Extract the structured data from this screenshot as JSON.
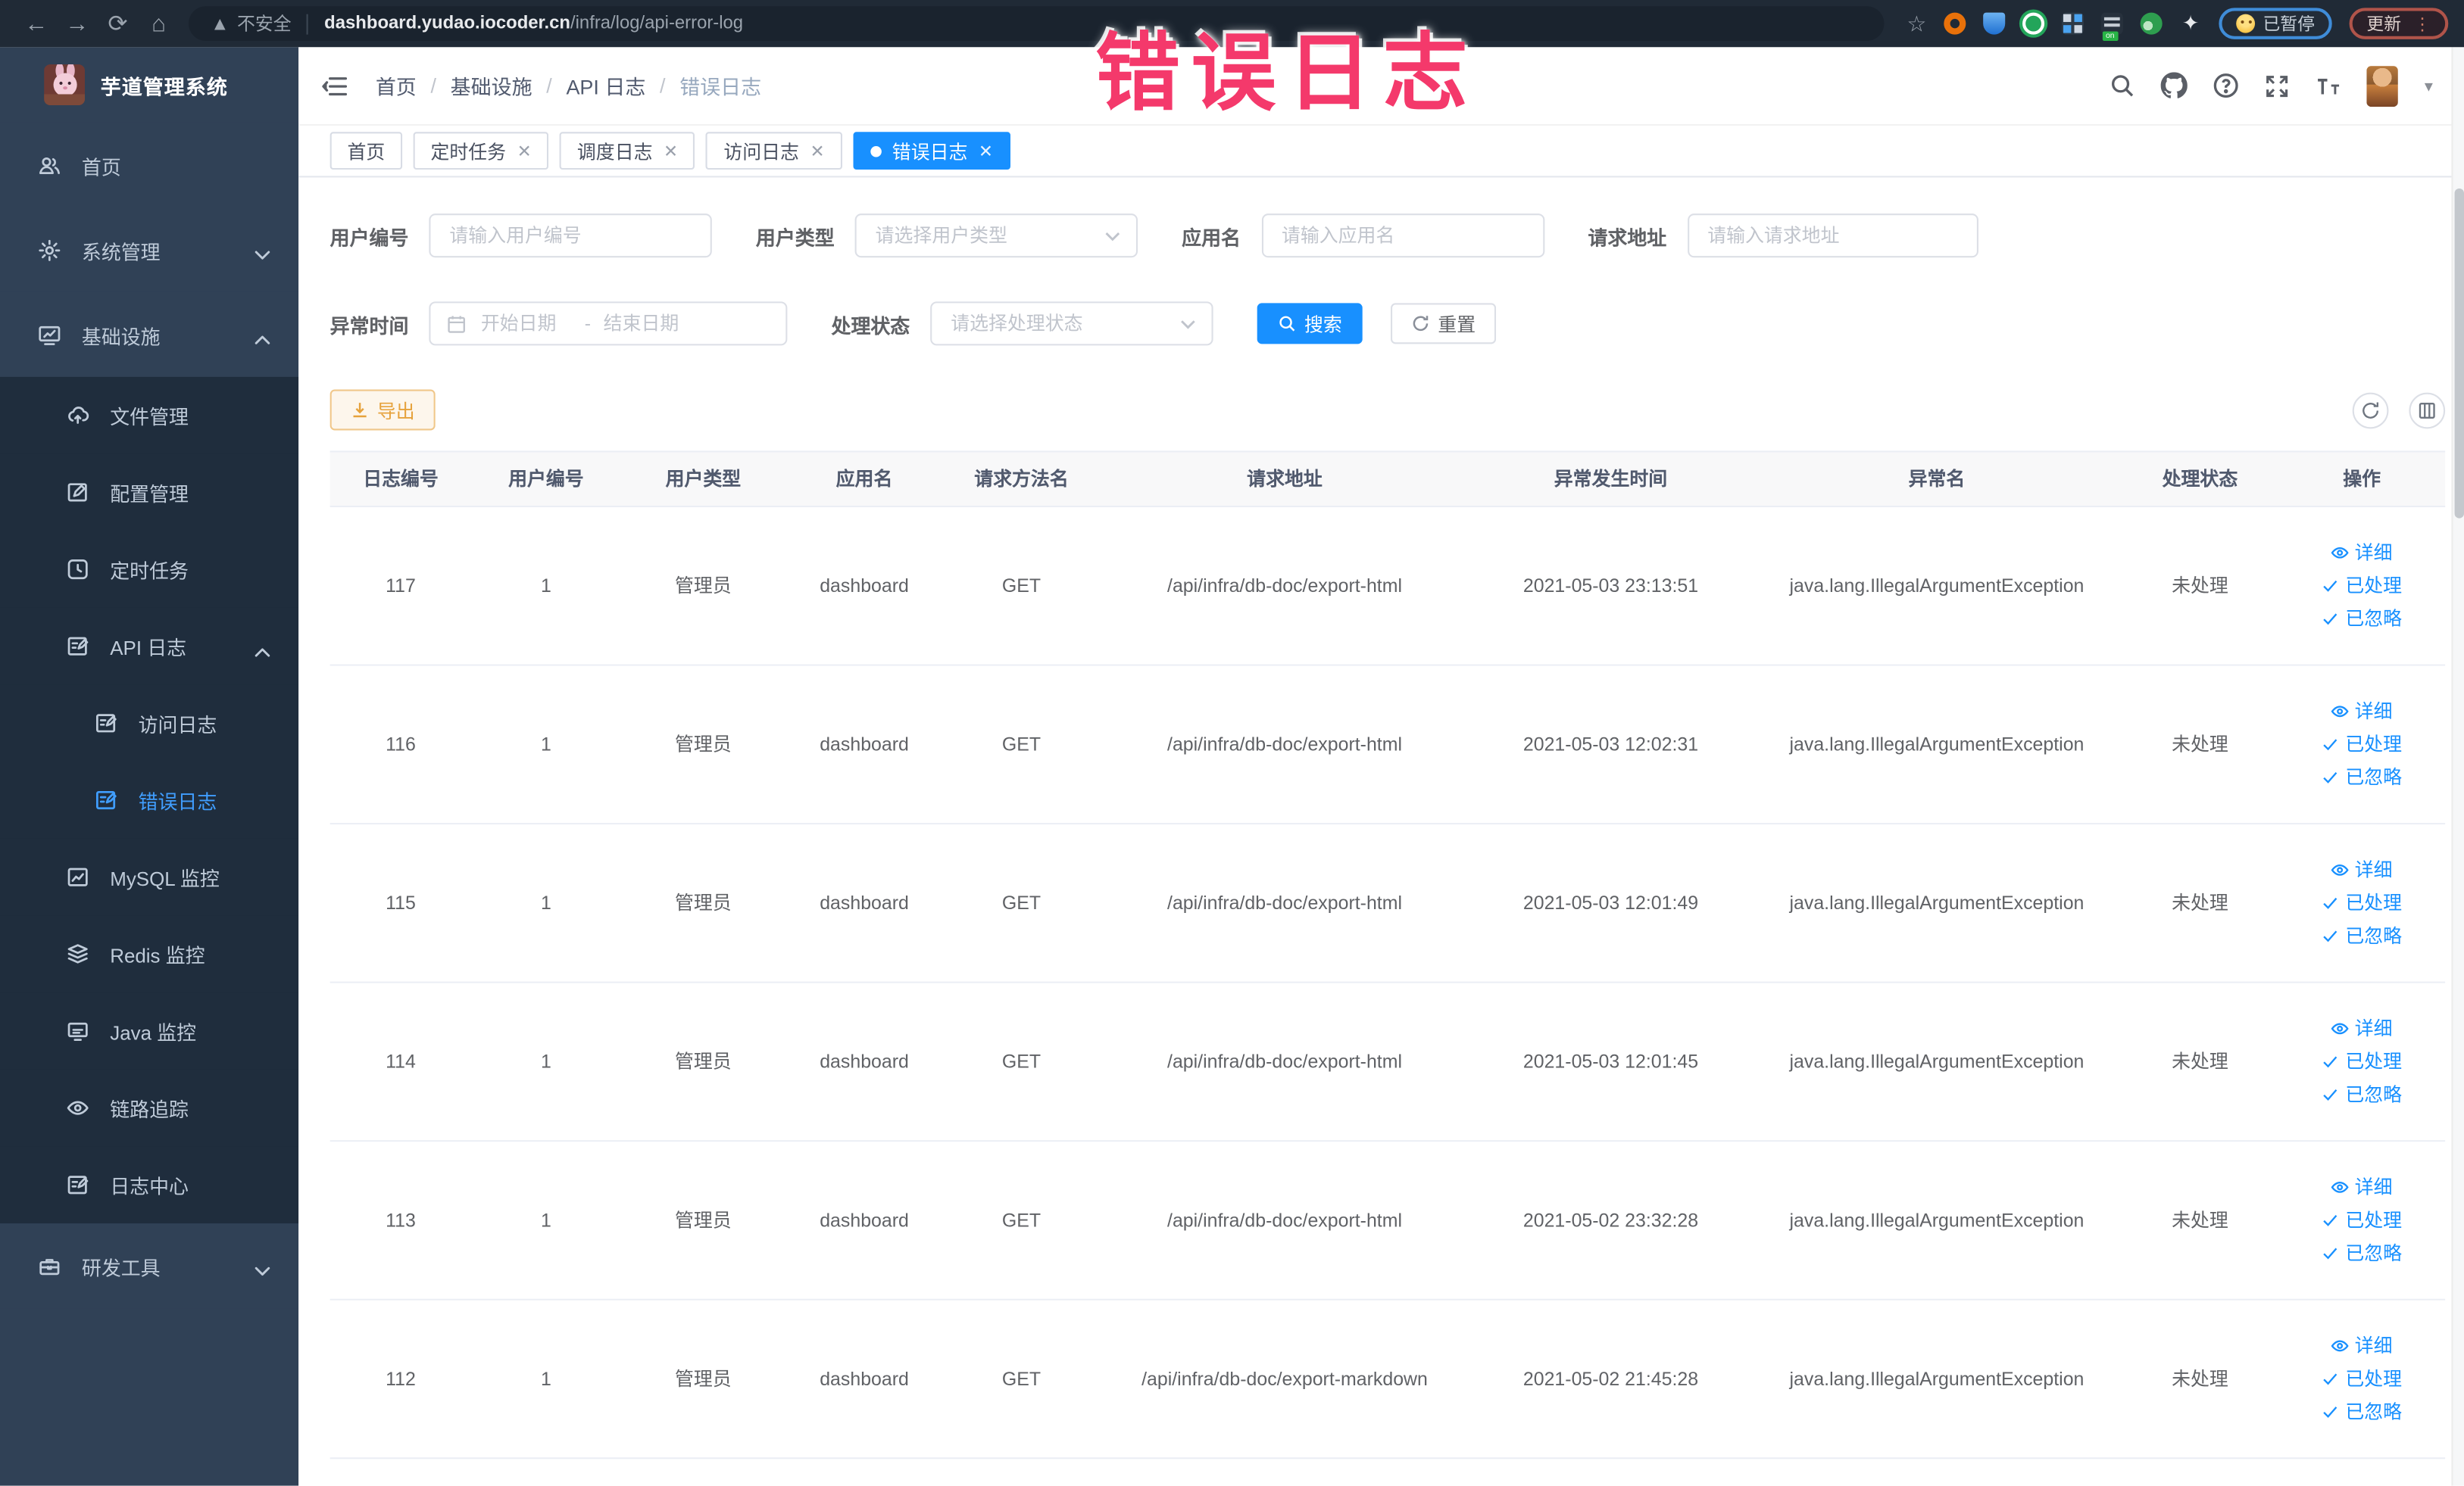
{
  "browser": {
    "security_label": "不安全",
    "url_host": "dashboard.yudao.iocoder.cn",
    "url_path": "/infra/log/api-error-log",
    "paused_badge": "已暂停",
    "update_button": "更新"
  },
  "annotation": {
    "text": "错误日志",
    "color": "#f4396b"
  },
  "sidebar": {
    "title": "芋道管理系统",
    "items": [
      {
        "label": "首页"
      },
      {
        "label": "系统管理"
      },
      {
        "label": "基础设施"
      },
      {
        "label": "文件管理"
      },
      {
        "label": "配置管理"
      },
      {
        "label": "定时任务"
      },
      {
        "label": "API 日志"
      },
      {
        "label": "访问日志"
      },
      {
        "label": "错误日志"
      },
      {
        "label": "MySQL 监控"
      },
      {
        "label": "Redis 监控"
      },
      {
        "label": "Java 监控"
      },
      {
        "label": "链路追踪"
      },
      {
        "label": "日志中心"
      },
      {
        "label": "研发工具"
      }
    ]
  },
  "breadcrumb": [
    "首页",
    "基础设施",
    "API 日志",
    "错误日志"
  ],
  "tabs": [
    {
      "label": "首页"
    },
    {
      "label": "定时任务"
    },
    {
      "label": "调度日志"
    },
    {
      "label": "访问日志"
    },
    {
      "label": "错误日志"
    }
  ],
  "filters": {
    "user_id": {
      "label": "用户编号",
      "placeholder": "请输入用户编号"
    },
    "user_type": {
      "label": "用户类型",
      "placeholder": "请选择用户类型"
    },
    "app_name": {
      "label": "应用名",
      "placeholder": "请输入应用名"
    },
    "request_url": {
      "label": "请求地址",
      "placeholder": "请输入请求地址"
    },
    "exception_time": {
      "label": "异常时间",
      "start_placeholder": "开始日期",
      "separator": "-",
      "end_placeholder": "结束日期"
    },
    "process_status": {
      "label": "处理状态",
      "placeholder": "请选择处理状态"
    },
    "search_button": "搜索",
    "reset_button": "重置"
  },
  "toolbar": {
    "export_button": "导出"
  },
  "table": {
    "columns": [
      "日志编号",
      "用户编号",
      "用户类型",
      "应用名",
      "请求方法名",
      "请求地址",
      "异常发生时间",
      "异常名",
      "处理状态",
      "操作"
    ],
    "row_actions": [
      "详细",
      "已处理",
      "已忽略"
    ],
    "rows": [
      {
        "log_id": "117",
        "user_id": "1",
        "user_type": "管理员",
        "app_name": "dashboard",
        "method": "GET",
        "url": "/api/infra/db-doc/export-html",
        "time": "2021-05-03 23:13:51",
        "exception": "java.lang.IllegalArgumentException",
        "status": "未处理"
      },
      {
        "log_id": "116",
        "user_id": "1",
        "user_type": "管理员",
        "app_name": "dashboard",
        "method": "GET",
        "url": "/api/infra/db-doc/export-html",
        "time": "2021-05-03 12:02:31",
        "exception": "java.lang.IllegalArgumentException",
        "status": "未处理"
      },
      {
        "log_id": "115",
        "user_id": "1",
        "user_type": "管理员",
        "app_name": "dashboard",
        "method": "GET",
        "url": "/api/infra/db-doc/export-html",
        "time": "2021-05-03 12:01:49",
        "exception": "java.lang.IllegalArgumentException",
        "status": "未处理"
      },
      {
        "log_id": "114",
        "user_id": "1",
        "user_type": "管理员",
        "app_name": "dashboard",
        "method": "GET",
        "url": "/api/infra/db-doc/export-html",
        "time": "2021-05-03 12:01:45",
        "exception": "java.lang.IllegalArgumentException",
        "status": "未处理"
      },
      {
        "log_id": "113",
        "user_id": "1",
        "user_type": "管理员",
        "app_name": "dashboard",
        "method": "GET",
        "url": "/api/infra/db-doc/export-html",
        "time": "2021-05-02 23:32:28",
        "exception": "java.lang.IllegalArgumentException",
        "status": "未处理"
      },
      {
        "log_id": "112",
        "user_id": "1",
        "user_type": "管理员",
        "app_name": "dashboard",
        "method": "GET",
        "url": "/api/infra/db-doc/export-markdown",
        "time": "2021-05-02 21:45:28",
        "exception": "java.lang.IllegalArgumentException",
        "status": "未处理"
      }
    ]
  },
  "colors": {
    "accent": "#1890ff",
    "active_menu": "#409eff",
    "sidebar_bg": "#304156",
    "sidebar_submenu_bg": "#1f2d3d",
    "warning": "#e6a23c",
    "annotation_pink": "#f4396b",
    "chrome_bg": "#202a36"
  }
}
